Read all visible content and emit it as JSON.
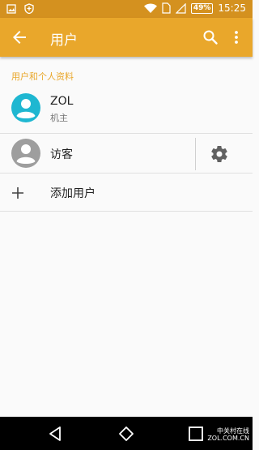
{
  "status_bar": {
    "battery": "49%",
    "time": "15:25"
  },
  "app_bar": {
    "title": "用户"
  },
  "section": {
    "header": "用户和个人资料"
  },
  "users": [
    {
      "name": "ZOL",
      "subtitle": "机主"
    },
    {
      "name": "访客"
    }
  ],
  "add_user": {
    "label": "添加用户"
  },
  "watermark": {
    "line1": "中关村在线",
    "line2": "ZOL.COM.CN"
  },
  "colors": {
    "accent": "#e9a72b",
    "status_bar": "#d4911f",
    "owner_avatar": "#1fb7d1",
    "guest_avatar": "#9e9e9e"
  }
}
